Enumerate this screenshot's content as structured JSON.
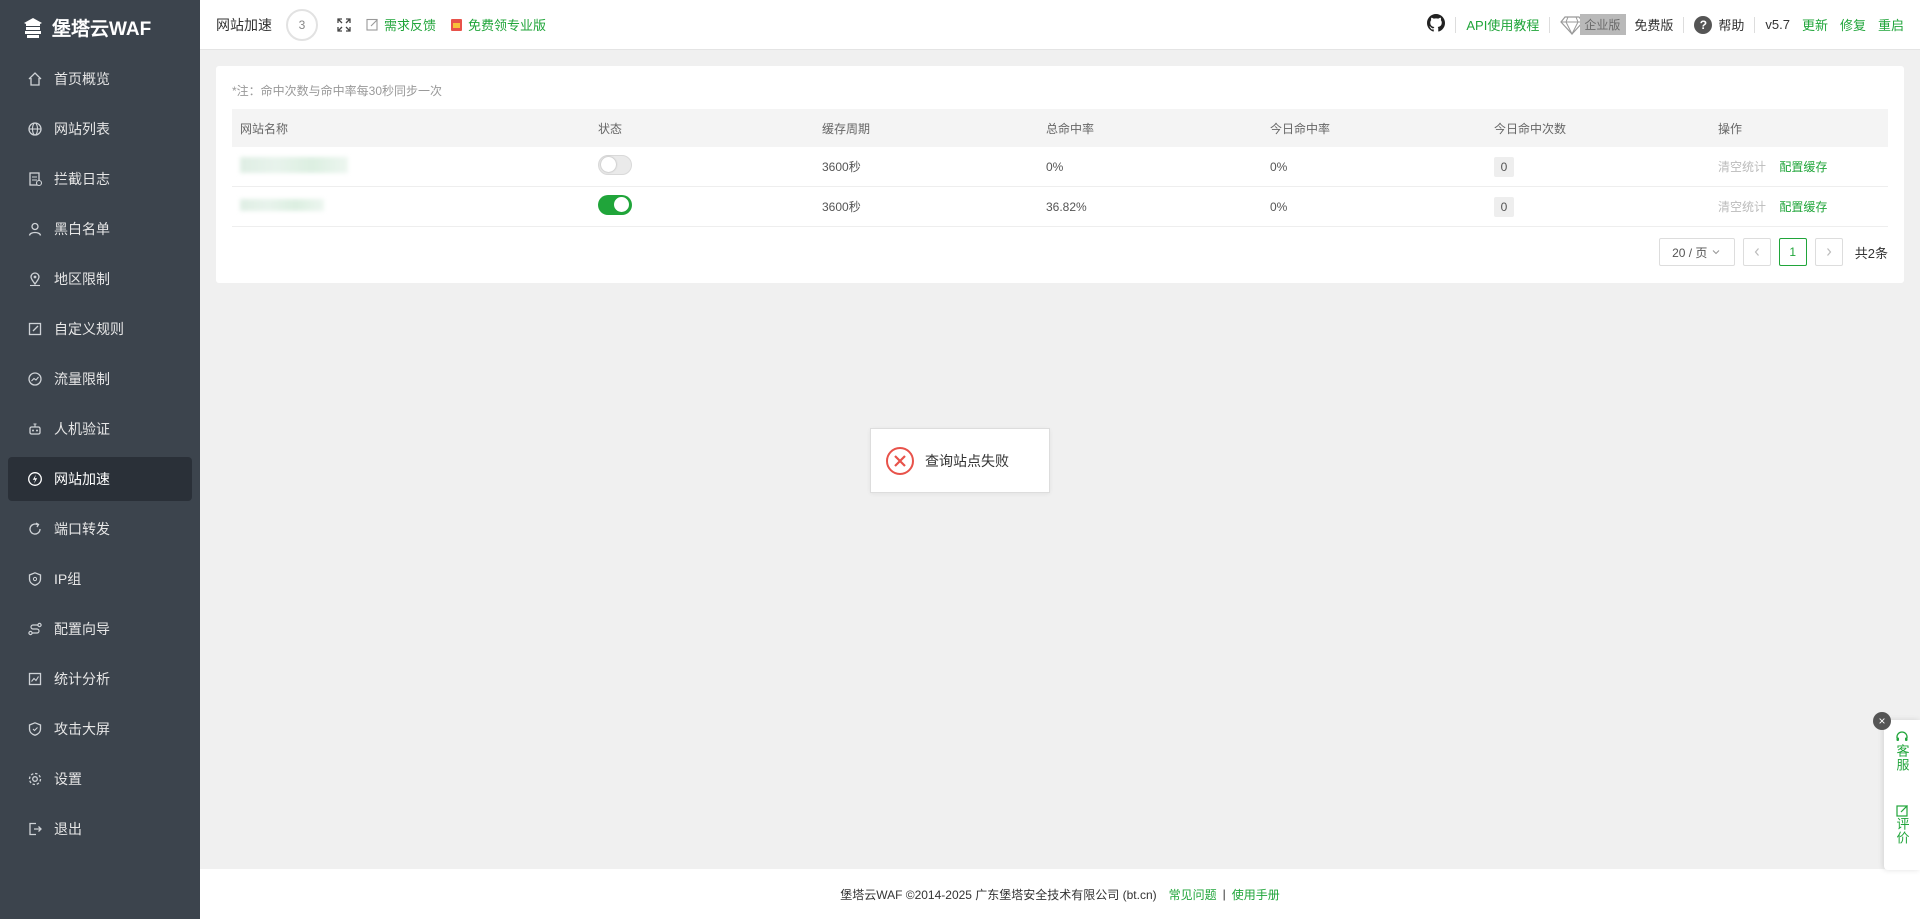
{
  "app": {
    "name": "堡塔云WAF"
  },
  "sidebar": {
    "items": [
      {
        "label": "首页概览",
        "icon": "home-icon"
      },
      {
        "label": "网站列表",
        "icon": "globe-icon"
      },
      {
        "label": "拦截日志",
        "icon": "log-icon"
      },
      {
        "label": "黑白名单",
        "icon": "user-icon"
      },
      {
        "label": "地区限制",
        "icon": "location-icon"
      },
      {
        "label": "自定义规则",
        "icon": "edit-icon"
      },
      {
        "label": "流量限制",
        "icon": "gauge-icon"
      },
      {
        "label": "人机验证",
        "icon": "robot-icon"
      },
      {
        "label": "网站加速",
        "icon": "bolt-icon",
        "active": true
      },
      {
        "label": "端口转发",
        "icon": "refresh-icon"
      },
      {
        "label": "IP组",
        "icon": "shield-icon"
      },
      {
        "label": "配置向导",
        "icon": "route-icon"
      },
      {
        "label": "统计分析",
        "icon": "chart-icon"
      },
      {
        "label": "攻击大屏",
        "icon": "shield-icon"
      },
      {
        "label": "设置",
        "icon": "gear-icon"
      },
      {
        "label": "退出",
        "icon": "logout-icon"
      }
    ]
  },
  "header": {
    "title": "网站加速",
    "badge": "3",
    "feedback": "需求反馈",
    "free_pro": "免费领专业版",
    "api_tutorial": "API使用教程",
    "enterprise": "企业版",
    "free_edition": "免费版",
    "help": "帮助",
    "version": "v5.7",
    "update": "更新",
    "repair": "修复",
    "restart": "重启"
  },
  "note": "*注：命中次数与命中率每30秒同步一次",
  "table": {
    "headers": [
      "网站名称",
      "状态",
      "缓存周期",
      "总命中率",
      "今日命中率",
      "今日命中次数",
      "操作"
    ],
    "rows": [
      {
        "status": false,
        "cache_period": "3600秒",
        "total_rate": "0%",
        "today_rate": "0%",
        "today_hits": "0",
        "clear": "清空统计",
        "config": "配置缓存"
      },
      {
        "status": true,
        "cache_period": "3600秒",
        "total_rate": "36.82%",
        "today_rate": "0%",
        "today_hits": "0",
        "clear": "清空统计",
        "config": "配置缓存"
      }
    ]
  },
  "pager": {
    "size": "20 / 页",
    "current": "1",
    "total": "共2条"
  },
  "toast": {
    "message": "查询站点失败"
  },
  "footer": {
    "copyright": "堡塔云WAF ©2014-2025 广东堡塔安全技术有限公司 (bt.cn)",
    "faq": "常见问题",
    "divider": "|",
    "manual": "使用手册"
  },
  "float": {
    "service": "客服",
    "review": "评价",
    "close": "×"
  },
  "colors": {
    "sidebar_bg": "#3c444d",
    "accent": "#20a53a",
    "error": "#e8524a"
  }
}
